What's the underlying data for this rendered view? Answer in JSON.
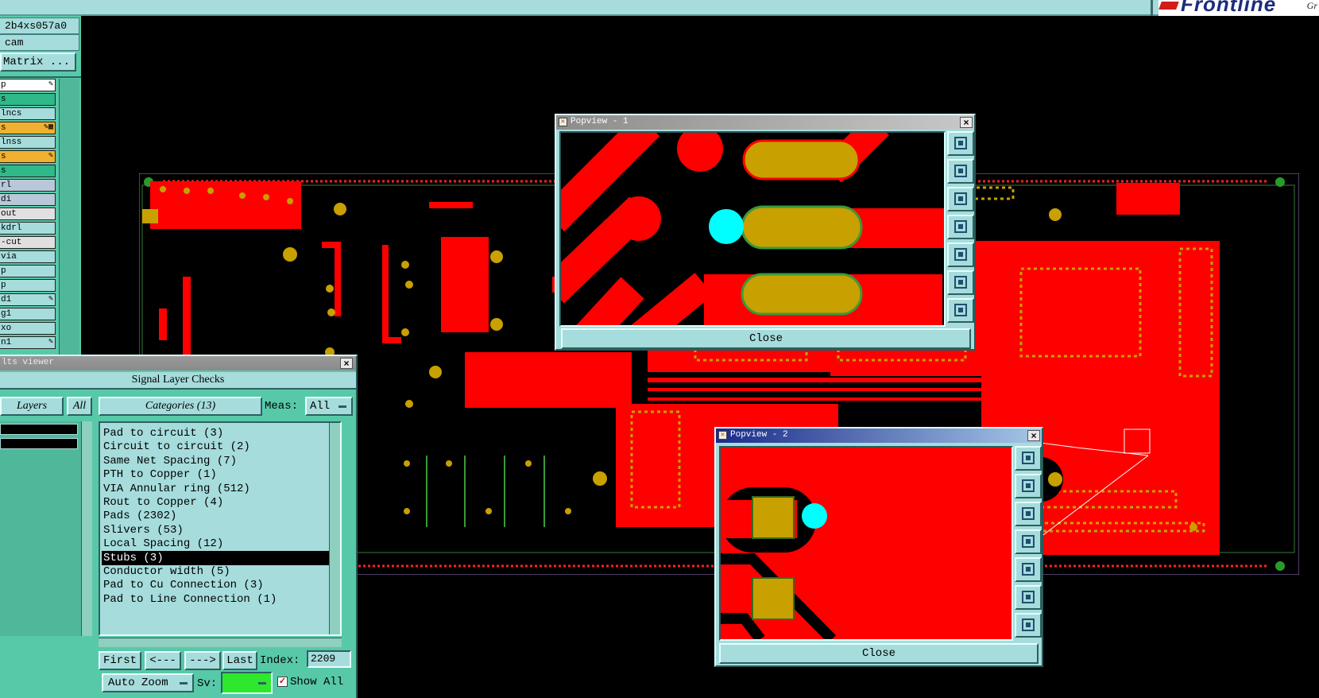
{
  "top_bar": {
    "brand_name": "Frontline",
    "brand_tag": "Gr"
  },
  "left_panel": {
    "job_name": "2b4xs057a0",
    "step_name": "cam",
    "matrix_button": "Matrix ...",
    "layers": [
      {
        "label": "p",
        "color": "#ffffff",
        "flag": "✎"
      },
      {
        "label": "s",
        "color": "#2fb888",
        "flag": ""
      },
      {
        "label": "lncs",
        "color": "#a6dcdc",
        "flag": ""
      },
      {
        "label": "s",
        "color": "#f0b030",
        "flag": "✎▦"
      },
      {
        "label": "lnss",
        "color": "#a6dcdc",
        "flag": ""
      },
      {
        "label": "s",
        "color": "#f0b030",
        "flag": "✎"
      },
      {
        "label": "s",
        "color": "#2fb888",
        "flag": ""
      },
      {
        "label": "rl",
        "color": "#b8c8d8",
        "flag": ""
      },
      {
        "label": "di",
        "color": "#b8c8d8",
        "flag": ""
      },
      {
        "label": "out",
        "color": "#e0e0e0",
        "flag": ""
      },
      {
        "label": "kdrl",
        "color": "#a6dcdc",
        "flag": ""
      },
      {
        "label": "-cut",
        "color": "#e0e0e0",
        "flag": ""
      },
      {
        "label": "via",
        "color": "#a6dcdc",
        "flag": ""
      },
      {
        "label": "p",
        "color": "#a6dcdc",
        "flag": ""
      },
      {
        "label": "p",
        "color": "#a6dcdc",
        "flag": ""
      },
      {
        "label": "d1",
        "color": "#a6dcdc",
        "flag": "✎"
      },
      {
        "label": "g1",
        "color": "#a6dcdc",
        "flag": ""
      },
      {
        "label": "xo",
        "color": "#a6dcdc",
        "flag": ""
      },
      {
        "label": "n1",
        "color": "#a6dcdc",
        "flag": "✎"
      }
    ]
  },
  "popview1": {
    "title": "Popview - 1",
    "close_label": "Close"
  },
  "popview2": {
    "title": "Popview - 2",
    "close_label": "Close"
  },
  "results": {
    "window_title": "lts viewer",
    "header": "Signal Layer Checks",
    "layers_label": "Layers",
    "layers_all": "All",
    "categories_label": "Categories (13)",
    "meas_label": "Meas:",
    "meas_value": "All",
    "categories": [
      "Pad to circuit (3)",
      "Circuit to circuit (2)",
      "Same Net Spacing (7)",
      "PTH to Copper (1)",
      "VIA Annular ring (512)",
      "Rout to Copper (4)",
      "Pads (2302)",
      "Slivers (53)",
      "Local Spacing (12)",
      "Stubs (3)",
      "Conductor width (5)",
      "Pad to Cu Connection (3)",
      "Pad to Line Connection (1)"
    ],
    "selected_category": "Stubs (3)",
    "nav": {
      "first": "First",
      "prev": "<---",
      "next": "--->",
      "last": "Last",
      "index_label": "Index:",
      "index_value": "2209"
    },
    "auto_zoom_label": "Auto Zoom",
    "sv_label": "Sv:",
    "show_all_label": "Show All",
    "show_all_checked": true
  },
  "colors": {
    "copper": "#ff0000",
    "pad": "#c8a000",
    "highlight": "#00ffff",
    "panel": "#a6dcdc",
    "panel_dark": "#58c9a8"
  }
}
